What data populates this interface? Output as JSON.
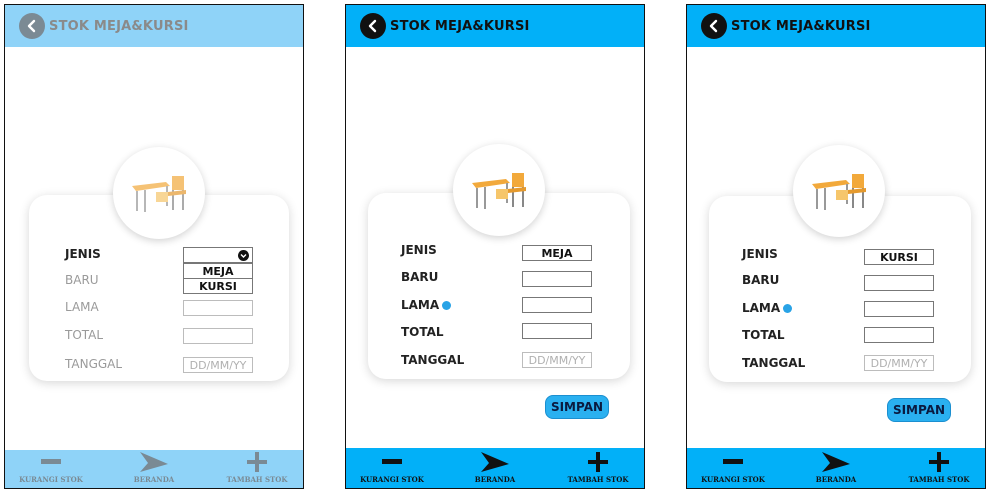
{
  "colors": {
    "active": "#02b0f8",
    "faded": "#8fd3f8",
    "accent_dot": "#29a3e6"
  },
  "app": {
    "title": "STOK MEJA&KURSI"
  },
  "form": {
    "labels": {
      "jenis": "JENIS",
      "baru": "BARU",
      "lama": "LAMA",
      "total": "TOTAL",
      "tanggal": "TANGGAL"
    },
    "date_placeholder": "DD/MM/YY",
    "dropdown_options": [
      "MEJA",
      "KURSI"
    ]
  },
  "screens": [
    {
      "jenis_value": ""
    },
    {
      "jenis_value": "MEJA"
    },
    {
      "jenis_value": "KURSI"
    }
  ],
  "buttons": {
    "save": "SIMPAN"
  },
  "nav": {
    "left": "KURANGI STOK",
    "center": "BERANDA",
    "right": "TAMBAH STOK"
  },
  "icons": [
    "back-arrow-icon",
    "desk-chair-icon",
    "minus-icon",
    "plane-icon",
    "plus-icon",
    "chevron-down-icon"
  ]
}
